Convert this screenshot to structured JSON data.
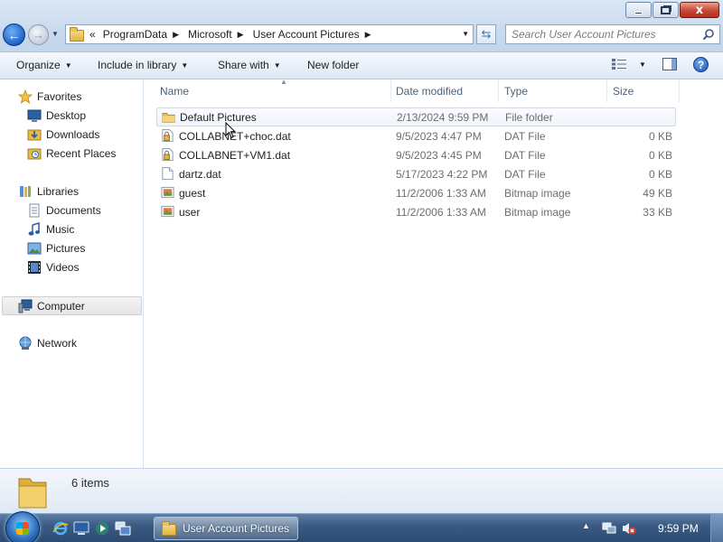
{
  "window": {
    "minimize_label": "",
    "maximize_label": "",
    "close_label": "x"
  },
  "nav": {
    "back_label": "←",
    "forward_label": "→"
  },
  "address": {
    "overflow": "«",
    "crumbs": [
      "ProgramData",
      "Microsoft",
      "User Account Pictures"
    ]
  },
  "search": {
    "placeholder": "Search User Account Pictures"
  },
  "toolbar": {
    "organize": "Organize",
    "include_in_library": "Include in library",
    "share_with": "Share with",
    "new_folder": "New folder",
    "help": "?"
  },
  "sidebar": {
    "favorites": "Favorites",
    "desktop": "Desktop",
    "downloads": "Downloads",
    "recent_places": "Recent Places",
    "libraries": "Libraries",
    "documents": "Documents",
    "music": "Music",
    "pictures": "Pictures",
    "videos": "Videos",
    "computer": "Computer",
    "network": "Network"
  },
  "columns": {
    "name": "Name",
    "date_modified": "Date modified",
    "type": "Type",
    "size": "Size"
  },
  "files": [
    {
      "name": "Default Pictures",
      "date": "2/13/2024 9:59 PM",
      "type": "File folder",
      "size": "",
      "icon": "folder-icon"
    },
    {
      "name": "COLLABNET+choc.dat",
      "date": "9/5/2023 4:47 PM",
      "type": "DAT File",
      "size": "0 KB",
      "icon": "locked-file-icon"
    },
    {
      "name": "COLLABNET+VM1.dat",
      "date": "9/5/2023 4:45 PM",
      "type": "DAT File",
      "size": "0 KB",
      "icon": "locked-file-icon"
    },
    {
      "name": "dartz.dat",
      "date": "5/17/2023 4:22 PM",
      "type": "DAT File",
      "size": "0 KB",
      "icon": "blank-file-icon"
    },
    {
      "name": "guest",
      "date": "11/2/2006 1:33 AM",
      "type": "Bitmap image",
      "size": "49 KB",
      "icon": "bitmap-icon"
    },
    {
      "name": "user",
      "date": "11/2/2006 1:33 AM",
      "type": "Bitmap image",
      "size": "33 KB",
      "icon": "bitmap-icon"
    }
  ],
  "details": {
    "item_count": "6 items"
  },
  "taskbar": {
    "active_window": "User Account Pictures",
    "clock": "9:59 PM"
  },
  "colors": {
    "titlebar": "#c9daee",
    "taskbar": "#3b5b83",
    "folder": "#e3b441"
  }
}
